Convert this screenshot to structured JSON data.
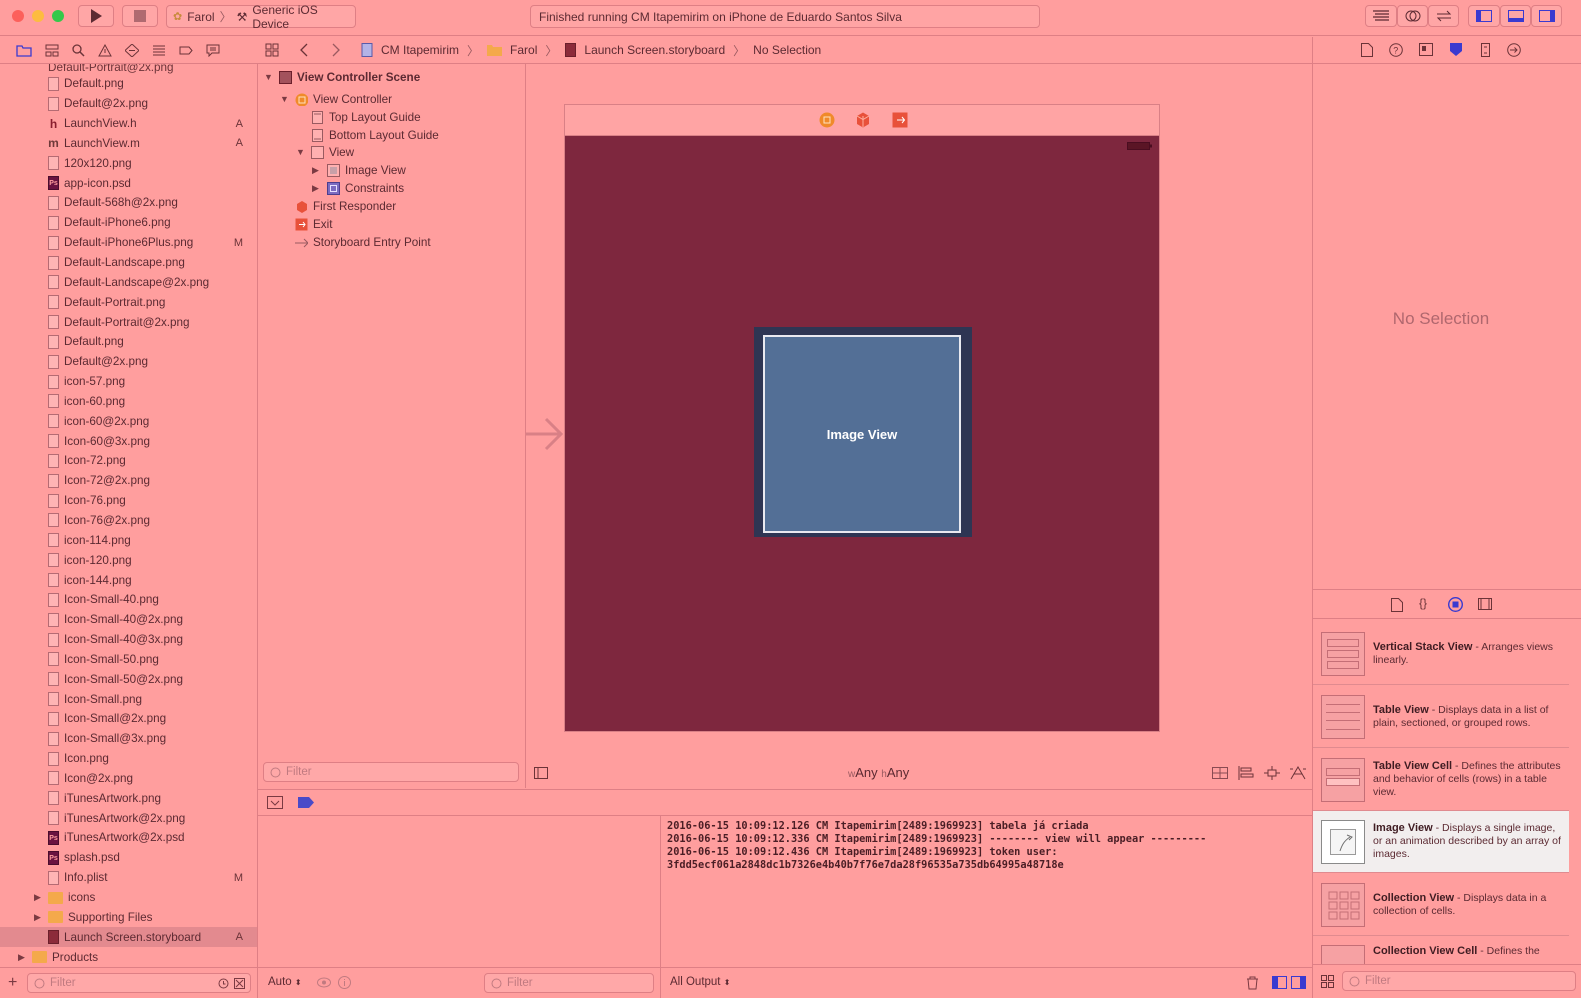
{
  "toolbar": {
    "scheme_name": "Farol",
    "device": "Generic iOS Device",
    "status": "Finished running CM Itapemirim on iPhone de Eduardo Santos Silva"
  },
  "jump_bar": {
    "project": "CM Itapemirim",
    "group": "Farol",
    "file": "Launch Screen.storyboard",
    "selection": "No Selection"
  },
  "navigator": {
    "files": [
      {
        "name": "Default.png",
        "icon": "png-file-icon",
        "badge": ""
      },
      {
        "name": "Default@2x.png",
        "icon": "png-file-icon",
        "badge": ""
      },
      {
        "name": "LaunchView.h",
        "icon": "header-file-icon",
        "badge": "A"
      },
      {
        "name": "LaunchView.m",
        "icon": "objc-file-icon",
        "badge": "A"
      },
      {
        "name": "120x120.png",
        "icon": "png-file-icon",
        "badge": ""
      },
      {
        "name": "app-icon.psd",
        "icon": "psd-file-icon",
        "badge": ""
      },
      {
        "name": "Default-568h@2x.png",
        "icon": "png-file-icon",
        "badge": ""
      },
      {
        "name": "Default-iPhone6.png",
        "icon": "png-file-icon",
        "badge": ""
      },
      {
        "name": "Default-iPhone6Plus.png",
        "icon": "png-file-icon",
        "badge": "M"
      },
      {
        "name": "Default-Landscape.png",
        "icon": "png-file-icon",
        "badge": ""
      },
      {
        "name": "Default-Landscape@2x.png",
        "icon": "png-file-icon",
        "badge": ""
      },
      {
        "name": "Default-Portrait.png",
        "icon": "png-file-icon",
        "badge": ""
      },
      {
        "name": "Default-Portrait@2x.png",
        "icon": "png-file-icon",
        "badge": ""
      },
      {
        "name": "Default.png",
        "icon": "png-file-icon",
        "badge": ""
      },
      {
        "name": "Default@2x.png",
        "icon": "png-file-icon",
        "badge": ""
      },
      {
        "name": "icon-57.png",
        "icon": "png-file-icon",
        "badge": ""
      },
      {
        "name": "icon-60.png",
        "icon": "png-file-icon",
        "badge": ""
      },
      {
        "name": "icon-60@2x.png",
        "icon": "png-file-icon",
        "badge": ""
      },
      {
        "name": "Icon-60@3x.png",
        "icon": "png-file-icon",
        "badge": ""
      },
      {
        "name": "Icon-72.png",
        "icon": "png-file-icon",
        "badge": ""
      },
      {
        "name": "Icon-72@2x.png",
        "icon": "png-file-icon",
        "badge": ""
      },
      {
        "name": "Icon-76.png",
        "icon": "png-file-icon",
        "badge": ""
      },
      {
        "name": "Icon-76@2x.png",
        "icon": "png-file-icon",
        "badge": ""
      },
      {
        "name": "icon-114.png",
        "icon": "png-file-icon",
        "badge": ""
      },
      {
        "name": "icon-120.png",
        "icon": "png-file-icon",
        "badge": ""
      },
      {
        "name": "icon-144.png",
        "icon": "png-file-icon",
        "badge": ""
      },
      {
        "name": "Icon-Small-40.png",
        "icon": "png-file-icon",
        "badge": ""
      },
      {
        "name": "Icon-Small-40@2x.png",
        "icon": "png-file-icon",
        "badge": ""
      },
      {
        "name": "Icon-Small-40@3x.png",
        "icon": "png-file-icon",
        "badge": ""
      },
      {
        "name": "Icon-Small-50.png",
        "icon": "png-file-icon",
        "badge": ""
      },
      {
        "name": "Icon-Small-50@2x.png",
        "icon": "png-file-icon",
        "badge": ""
      },
      {
        "name": "Icon-Small.png",
        "icon": "png-file-icon",
        "badge": ""
      },
      {
        "name": "Icon-Small@2x.png",
        "icon": "png-file-icon",
        "badge": ""
      },
      {
        "name": "Icon-Small@3x.png",
        "icon": "png-file-icon",
        "badge": ""
      },
      {
        "name": "Icon.png",
        "icon": "png-file-icon",
        "badge": ""
      },
      {
        "name": "Icon@2x.png",
        "icon": "png-file-icon",
        "badge": ""
      },
      {
        "name": "iTunesArtwork.png",
        "icon": "png-file-icon",
        "badge": ""
      },
      {
        "name": "iTunesArtwork@2x.png",
        "icon": "png-file-icon",
        "badge": ""
      },
      {
        "name": "iTunesArtwork@2x.psd",
        "icon": "psd-file-icon",
        "badge": ""
      },
      {
        "name": "splash.psd",
        "icon": "psd-file-icon",
        "badge": ""
      },
      {
        "name": "Info.plist",
        "icon": "plist-file-icon",
        "badge": "M"
      },
      {
        "name": "icons",
        "icon": "folder-icon",
        "badge": "",
        "group": true
      },
      {
        "name": "Supporting Files",
        "icon": "folder-icon",
        "badge": "",
        "group": true
      },
      {
        "name": "Launch Screen.storyboard",
        "icon": "storyboard-file-icon",
        "badge": "A",
        "selected": true
      },
      {
        "name": "Products",
        "icon": "folder-icon",
        "badge": "",
        "group": true,
        "top": true
      }
    ],
    "filter_placeholder": "Filter"
  },
  "outline": {
    "scene": "View Controller Scene",
    "view_controller": "View Controller",
    "top_guide": "Top Layout Guide",
    "bottom_guide": "Bottom Layout Guide",
    "view": "View",
    "image_view": "Image View",
    "constraints": "Constraints",
    "first_responder": "First Responder",
    "exit": "Exit",
    "entry_point": "Storyboard Entry Point",
    "filter_placeholder": "Filter"
  },
  "canvas": {
    "image_view_label": "Image View",
    "size_class_w_prefix": "w",
    "size_class_w": "Any",
    "size_class_h_prefix": "h",
    "size_class_h": "Any"
  },
  "debug": {
    "variables_mode": "Auto",
    "filter_placeholder": "Filter",
    "output_mode": "All Output",
    "console_lines": [
      "2016-06-15 10:09:12.126 CM Itapemirim[2489:1969923] tabela já criada",
      "2016-06-15 10:09:12.336 CM Itapemirim[2489:1969923] -------- view will appear ---------",
      "2016-06-15 10:09:12.436 CM Itapemirim[2489:1969923] token user:",
      "3fdd5ecf061a2848dc1b7326e4b40b7f76e7da28f96535a735db64995a48718e"
    ]
  },
  "inspector": {
    "no_selection": "No Selection",
    "library": [
      {
        "title": "Vertical Stack View",
        "desc": " - Arranges views linearly."
      },
      {
        "title": "Table View",
        "desc": " - Displays data in a list of plain, sectioned, or grouped rows."
      },
      {
        "title": "Table View Cell",
        "desc": " - Defines the attributes and behavior of cells (rows) in a table view."
      },
      {
        "title": "Image View",
        "desc": " - Displays a single image, or an animation described by an array of images.",
        "selected": true
      },
      {
        "title": "Collection View",
        "desc": " - Displays data in a collection of cells."
      },
      {
        "title": "Collection View Cell",
        "desc": " - Defines the"
      }
    ],
    "filter_placeholder": "Filter"
  },
  "colors": {
    "background": "#ff9e9e",
    "view_background": "#7e273e",
    "image_view": "#536f96",
    "selection": "#e38a8f"
  }
}
